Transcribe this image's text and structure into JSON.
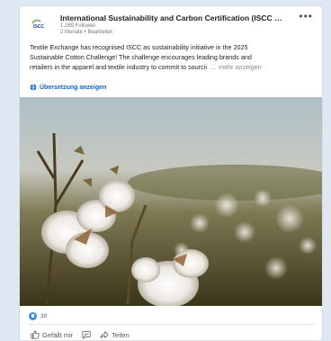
{
  "post": {
    "author_name": "International Sustainability and Carbon Certification (ISCC Sy...",
    "followers": "1.269 Follower",
    "meta": "2 Monate • Bearbeitet",
    "more_menu": "•••",
    "body_lines": [
      "Textile Exchange has recognised ISCC as sustainability initiative in the 2025",
      "Sustainable Cotton Challenge! The challenge encourages leading brands and",
      "retailers in the apparel and textile industry to commit to sourcii"
    ],
    "more_link": "… mehr anzeigen",
    "translate_label": "Übersetzung anzeigen"
  },
  "social": {
    "reaction_count": "30"
  },
  "actions": {
    "like": "Gefällt mir",
    "share": "Teilen"
  },
  "colors": {
    "link_blue": "#0a66c2",
    "reaction_blue": "#378fe9"
  }
}
